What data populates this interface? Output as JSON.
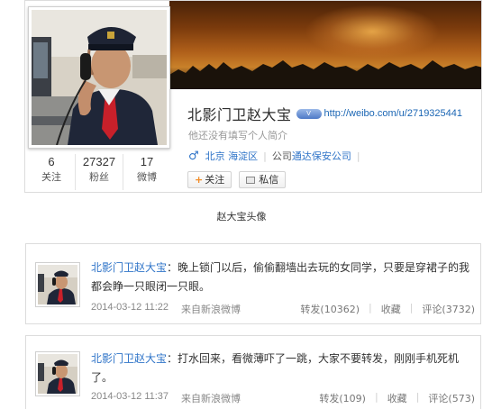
{
  "profile": {
    "name": "北影门卫赵大宝",
    "verify_badge": "V",
    "url": "http://weibo.com/u/2719325441",
    "bio": "他还没有填写个人简介",
    "gender_icon": "male-icon",
    "location": "北京 海淀区",
    "company_label": "公司",
    "company": "通达保安公司",
    "follow_button": "关注",
    "message_button": "私信",
    "stats": [
      {
        "value": "6",
        "label": "关注"
      },
      {
        "value": "27327",
        "label": "粉丝"
      },
      {
        "value": "17",
        "label": "微博"
      }
    ]
  },
  "caption": "赵大宝头像",
  "posts": [
    {
      "author": "北影门卫赵大宝",
      "content": "：晚上锁门以后，偷偷翻墙出去玩的女同学，只要是穿裙子的我都会睁一只眼闭一只眼。",
      "time": "2014-03-12 11:22",
      "source": "来自新浪微博",
      "repost": "转发(10362)",
      "favorite": "收藏",
      "comment": "评论(3732)"
    },
    {
      "author": "北影门卫赵大宝",
      "content": "：打水回来，看微薄吓了一跳，大家不要转发，刚刚手机死机了。",
      "time": "2014-03-12 11:37",
      "source": "来自新浪微博",
      "repost": "转发(109)",
      "favorite": "收藏",
      "comment": "评论(573)"
    }
  ],
  "colors": {
    "link": "#2f74c8",
    "url": "#1b66b4",
    "follow_plus": "#f28c27"
  }
}
